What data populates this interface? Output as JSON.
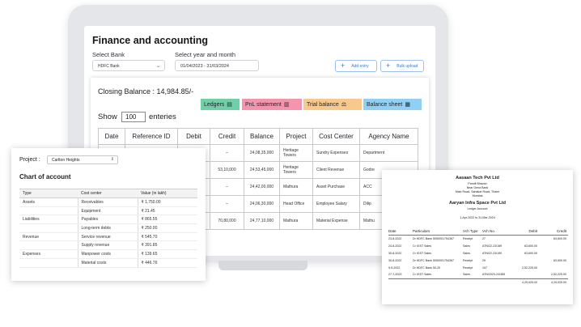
{
  "app": {
    "title": "Finance and accounting",
    "bank_label": "Select Bank",
    "bank_value": "HDFC Bank",
    "year_label": "Select year and month",
    "year_value": "01/04/2023 - 31/03/2024",
    "add_entry": "Add entry",
    "bulk_upload": "Bulk upload"
  },
  "ledger": {
    "closing_balance": "Closing Balance : 14,984.85/-",
    "tabs": [
      "Ledgers",
      "PnL statement",
      "Trial balance",
      "Balance sheet"
    ],
    "show_label": "Show",
    "show_value": "100",
    "entries_label": "enteries",
    "columns": [
      "Date",
      "Reference ID",
      "Debit",
      "Credit",
      "Balance",
      "Project",
      "Cost Center",
      "Agency Name"
    ],
    "rows": [
      [
        "",
        "",
        "",
        "–",
        "24,08,35,000",
        "Heritage Towers",
        "Sundry Expenses",
        "Department"
      ],
      [
        "",
        "",
        "",
        "53,10,000",
        "24,53,45,000",
        "Heritage Towers",
        "Client Revenue",
        "Godre"
      ],
      [
        "",
        "",
        "",
        "–",
        "24,42,00,000",
        "Mathura",
        "Asset Purchase",
        "ACC"
      ],
      [
        "",
        "",
        "",
        "–",
        "24,06,30,000",
        "Head Office",
        "Employee Salary",
        "Dilip"
      ],
      [
        "",
        "",
        "",
        "70,80,000",
        "24,77,10,000",
        "Mathura",
        "Material Expense",
        "Mathu"
      ]
    ]
  },
  "coa": {
    "project_label": "Project :",
    "project_value": "Carlton Heights",
    "title": "Chart of account",
    "columns": [
      "Type",
      "Cost center",
      "Value (in lakh)"
    ],
    "rows": [
      [
        "Assets",
        "Receivables",
        "₹ 1,750.00"
      ],
      [
        "",
        "Equipment",
        "₹ 21.45"
      ],
      [
        "Liabilities",
        "Payables",
        "₹ 865.55"
      ],
      [
        "",
        "Long-term debts",
        "₹ 250.00"
      ],
      [
        "Revenue",
        "Service revenue",
        "₹ 545.70"
      ],
      [
        "",
        "Supply revenue",
        "₹ 391.85"
      ],
      [
        "Expenses",
        "Manpower costs",
        "₹ 139.65"
      ],
      [
        "",
        "Material costs",
        "₹ 446.76"
      ]
    ]
  },
  "voucher": {
    "company": "Aasaan Tech Pvt Ltd",
    "addr1": "Pandit Bhavan",
    "addr2": "Near Dena Bank",
    "addr3": "Main Road, Sahakar Road, Thane",
    "addr4": "Mumbai",
    "party": "Aaryan Infra Space Pvt Ltd",
    "ledger_label": "Ledger Account",
    "period": "1-Apr-2022 to 31-Mar-2024",
    "columns": [
      "Date",
      "Particulars",
      "Vch Type",
      "Vch No.",
      "Debit",
      "Credit"
    ],
    "rows": [
      [
        "23-8-2022",
        "Dr HDFC Bank 5050001754367",
        "Receipt",
        "27",
        "",
        "63,600.00"
      ],
      [
        "24-8-2022",
        "Cr IGST Sales",
        "Sales",
        "ATN/22-23/189",
        "63,600.00",
        ""
      ],
      [
        "30-8-2022",
        "Cr IGST Sales",
        "Sales",
        "ATN/22-23/190",
        "63,600.00",
        ""
      ],
      [
        "30-8-2022",
        "Dr HDFC Bank 5050001754367",
        "Receipt",
        "29",
        "",
        "63,600.00"
      ],
      [
        "9-9-2022",
        "Dr HDFC Bank 50-20",
        "Receipt",
        "107",
        "2,52,225.00",
        ""
      ],
      [
        "27-7-2023",
        "Cr IGST Sales",
        "Sales",
        "ATN/2023-24/365",
        "",
        "2,52,225.00"
      ]
    ],
    "total_debit": "4,29,025.00",
    "total_credit": "4,29,025.00"
  }
}
